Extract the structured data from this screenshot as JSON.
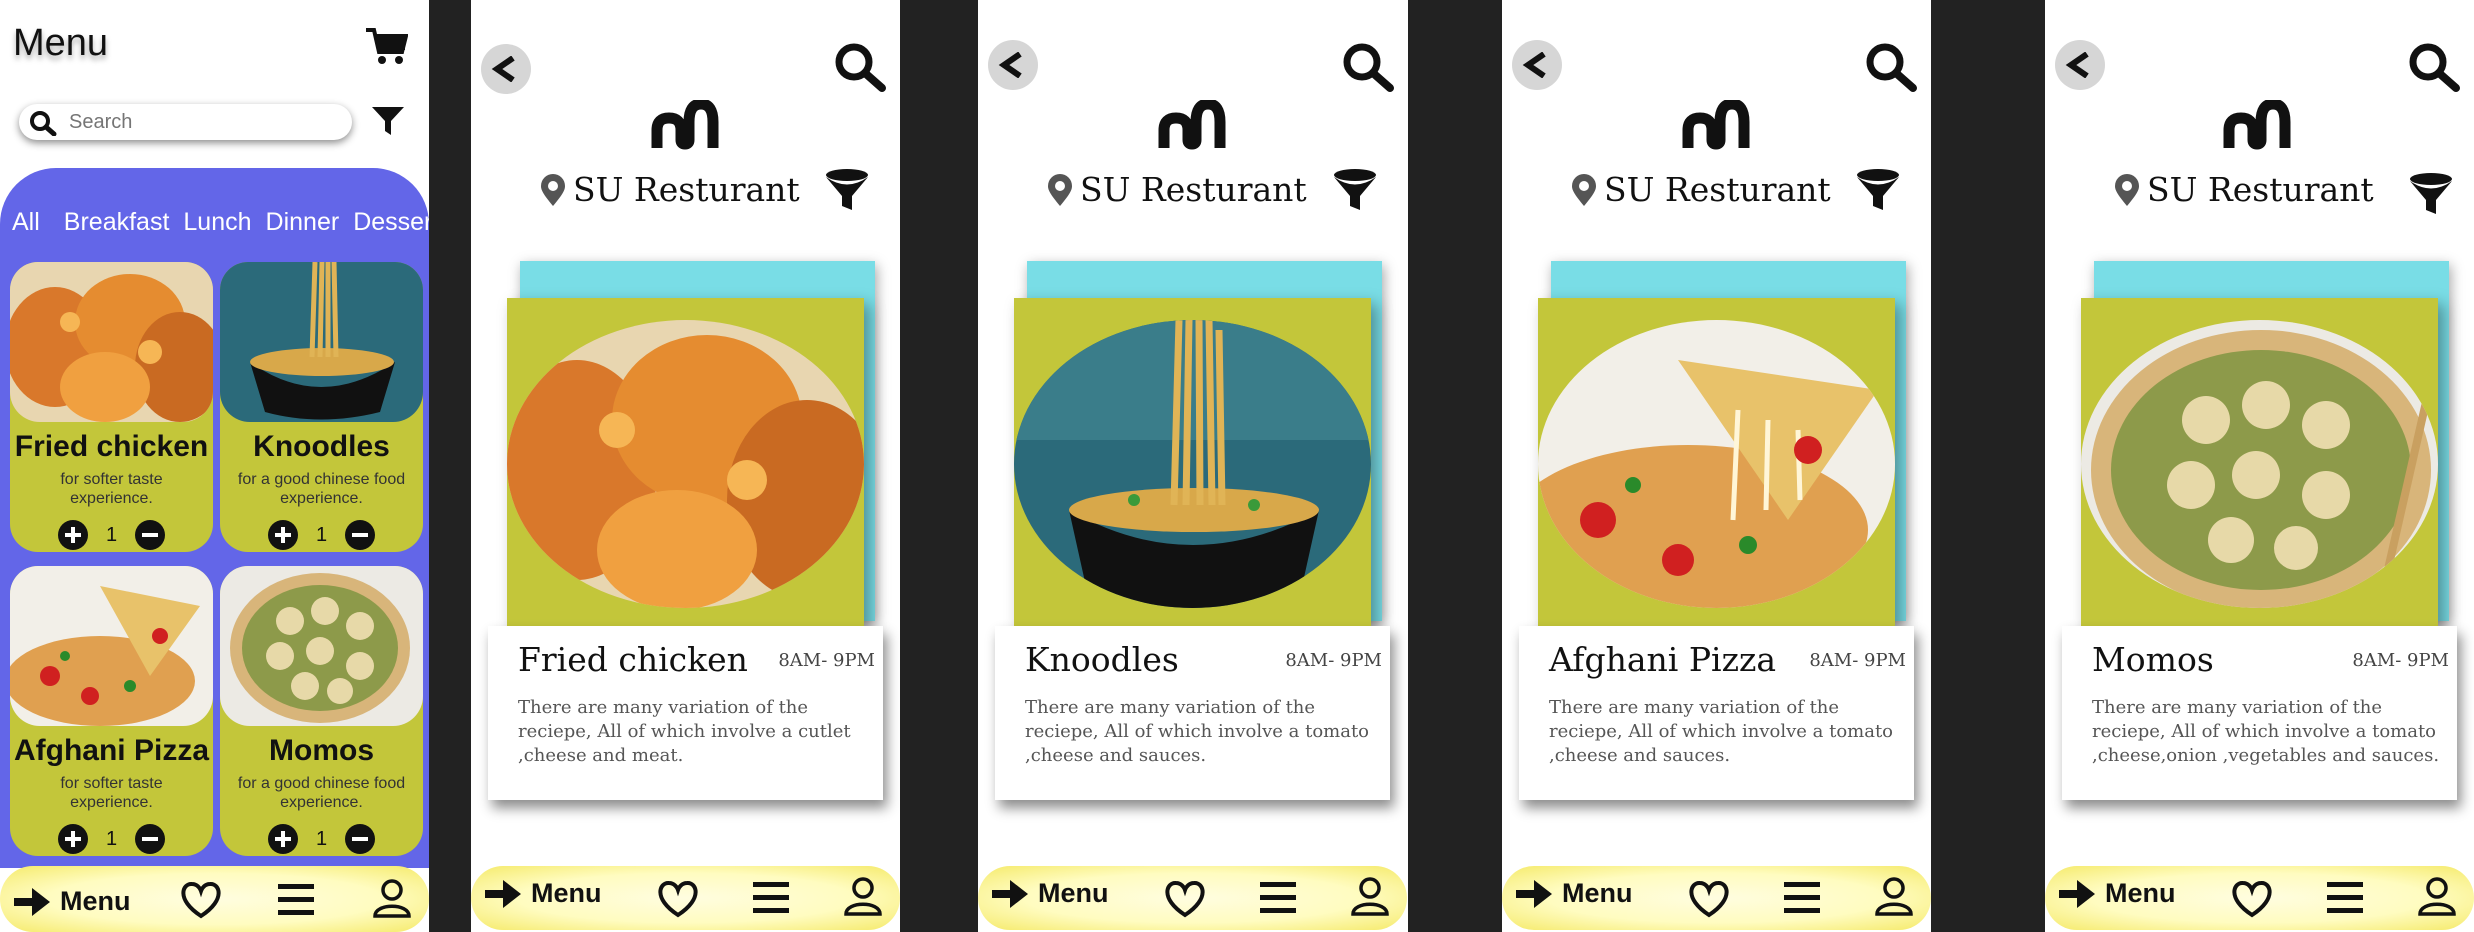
{
  "menu_screen": {
    "title": "Menu",
    "search_placeholder": "Search",
    "categories": [
      "All",
      "Breakfast",
      "Lunch",
      "Dinner",
      "Dessert"
    ],
    "items": [
      {
        "name": "Fried chicken",
        "desc": "for softer taste experience.",
        "qty": "1"
      },
      {
        "name": "Knoodles",
        "desc": "for a good chinese food experience.",
        "qty": "1"
      },
      {
        "name": "Afghani Pizza",
        "desc": "for softer taste experience.",
        "qty": "1"
      },
      {
        "name": "Momos",
        "desc": "for a good chinese food experience.",
        "qty": "1"
      }
    ]
  },
  "restaurant": {
    "name": "SU Resturant"
  },
  "details": [
    {
      "name": "Fried chicken",
      "hours": "8AM- 9PM",
      "desc": "There are many variation of the reciepe, All of which involve a cutlet ,cheese and meat."
    },
    {
      "name": "Knoodles",
      "hours": "8AM- 9PM",
      "desc": "There are many variation of the reciepe, All of which involve a tomato ,cheese and sauces."
    },
    {
      "name": "Afghani Pizza",
      "hours": "8AM- 9PM",
      "desc": "There are many variation of the reciepe, All of which involve a tomato ,cheese and sauces."
    },
    {
      "name": "Momos",
      "hours": "8AM- 9PM",
      "desc": "There are many variation of the reciepe, All of which involve a tomato ,cheese,onion ,vegetables and sauces."
    }
  ],
  "bottom_bar": {
    "menu_label": "Menu"
  },
  "colors": {
    "panel": "#6366e8",
    "card": "#c3c63a",
    "cyan": "#79dde6",
    "bar": "#fffcc0"
  },
  "icons": [
    "cart-icon",
    "search-icon",
    "filter-icon",
    "plus-icon",
    "minus-icon",
    "back-icon",
    "logo-icon",
    "location-pin-icon",
    "funnel-icon",
    "arrow-right-icon",
    "heart-icon",
    "hamburger-icon",
    "user-icon"
  ]
}
